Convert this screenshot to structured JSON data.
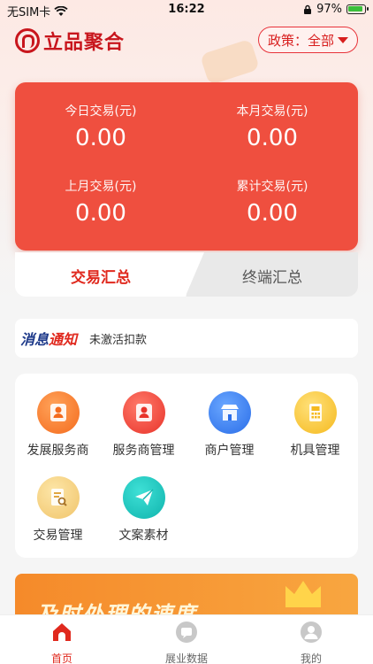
{
  "status_bar": {
    "carrier": "无SIM卡",
    "time": "16:22",
    "battery": "97%",
    "battery_level": 0.97
  },
  "header": {
    "logo_text": "立品聚合",
    "policy_label": "政策：全部"
  },
  "stats": [
    {
      "label": "今日交易(元)",
      "value": "0.00"
    },
    {
      "label": "本月交易(元)",
      "value": "0.00"
    },
    {
      "label": "上月交易(元)",
      "value": "0.00"
    },
    {
      "label": "累计交易(元)",
      "value": "0.00"
    }
  ],
  "tabs": {
    "active": "交易汇总",
    "inactive": "终端汇总"
  },
  "notice": {
    "logo_part1": "消息",
    "logo_part2": "通知",
    "text": "未激活扣款"
  },
  "menu": [
    {
      "label": "发展服务商",
      "icon": "person-badge-icon",
      "color": "#f46b1d"
    },
    {
      "label": "服务商管理",
      "icon": "person-badge-icon",
      "color": "#e8332a"
    },
    {
      "label": "商户管理",
      "icon": "storefront-icon",
      "color": "#2a6de8"
    },
    {
      "label": "机具管理",
      "icon": "pos-terminal-icon",
      "color": "#f5b91e"
    },
    {
      "label": "交易管理",
      "icon": "document-search-icon",
      "color": "#f0c46a"
    },
    {
      "label": "文案素材",
      "icon": "paper-plane-icon",
      "color": "#10b4ad"
    }
  ],
  "banner": {
    "text": "及时处理的速度"
  },
  "tabbar": {
    "home": "首页",
    "data": "展业数据",
    "mine": "我的"
  },
  "colors": {
    "accent": "#e0291e",
    "card": "#ef4f3f"
  }
}
